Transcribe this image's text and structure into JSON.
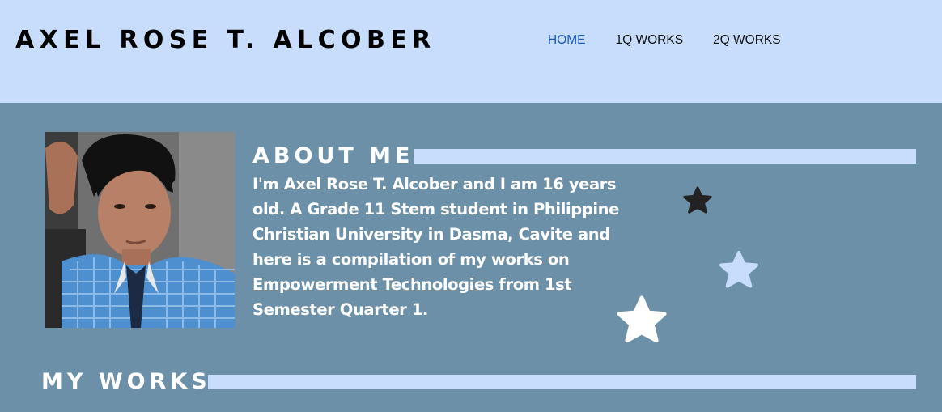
{
  "header": {
    "site_title": "AXEL ROSE T. ALCOBER",
    "nav": [
      {
        "label": "HOME",
        "active": true
      },
      {
        "label": "1Q WORKS",
        "active": false
      },
      {
        "label": "2Q WORKS",
        "active": false
      }
    ]
  },
  "about": {
    "heading": "ABOUT ME",
    "text_before_link": "I'm Axel Rose T. Alcober and I am 16 years old. A Grade 11 Stem student in Philippine Christian University in Dasma, Cavite and here is a compilation of my works on ",
    "link_text": "Empowerment Technologies",
    "text_after_link": " from 1st Semester Quarter 1."
  },
  "works": {
    "heading": "MY WORKS"
  },
  "colors": {
    "header_bg": "#c7ddfb",
    "page_bg": "#6c90a8",
    "nav_active": "#1a5bbf",
    "accent_bar": "#c7ddfb",
    "star_dark": "#222222",
    "star_light": "#c7ddfb",
    "star_white": "#ffffff"
  },
  "decorations": {
    "stars": [
      "star-dark-icon",
      "star-light-icon",
      "star-white-icon"
    ],
    "photo": "profile-photo"
  }
}
